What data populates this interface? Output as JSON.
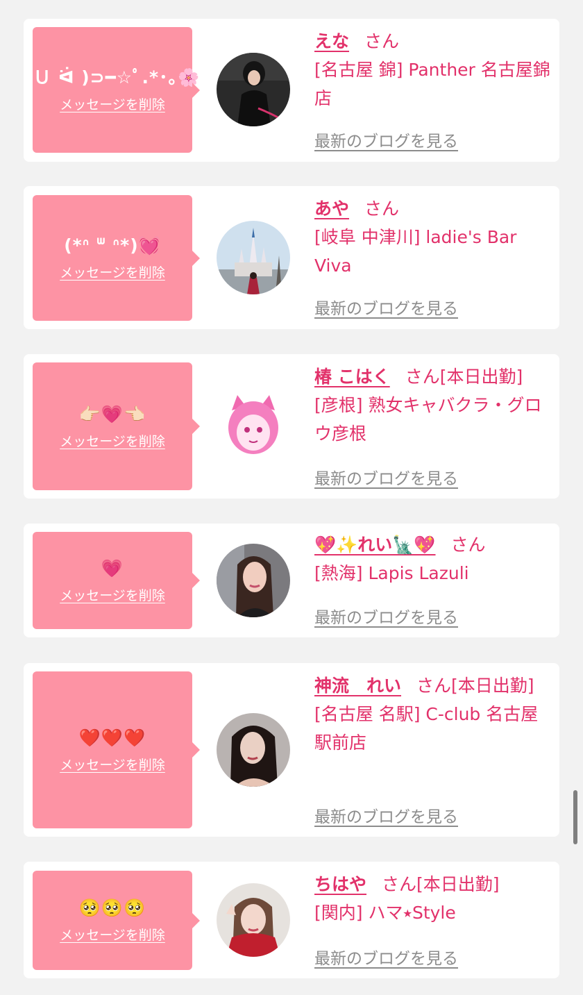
{
  "delete_label": "メッセージを削除",
  "blog_label": "最新のブログを見る",
  "colors": {
    "accent": "#e2316a",
    "bubble": "#fd93a4",
    "link_gray": "#8c8c8c",
    "background": "#f2f2f2"
  },
  "cards": [
    {
      "message": "(Ｕ ᐛ )⊃━☆ﾟ.*･｡🌸",
      "name": "えな",
      "honorific": "さん",
      "status": "",
      "shop": "[名古屋 錦] Panther 名古屋錦店",
      "avatar": "avatar-photo-panther"
    },
    {
      "message": "(*ᐢ ᐜ ᐢ*)💓",
      "name": "あや",
      "honorific": "さん",
      "status": "",
      "shop": "[岐阜 中津川] ladie's Bar Viva",
      "avatar": "avatar-photo-castle"
    },
    {
      "message": "👉🏻💗👈🏻",
      "name": "椿 こはく",
      "honorific": "さん",
      "status": "[本日出勤]",
      "shop": "[彦根] 熟女キャバクラ・グロウ彦根",
      "avatar": "avatar-illustration"
    },
    {
      "message": "💗",
      "name": "💖✨れい🗽💖",
      "honorific": "さん",
      "status": "",
      "shop": "[熱海] Lapis Lazuli",
      "avatar": "avatar-photo-woman"
    },
    {
      "message": "❤️❤️❤️",
      "name": "神流　れい",
      "honorific": "さん",
      "status": "[本日出勤]",
      "shop": "[名古屋 名駅] C-club 名古屋駅前店",
      "avatar": "avatar-photo-woman"
    },
    {
      "message": "🥺🥺🥺",
      "name": "ちはや",
      "honorific": "さん",
      "status": "[本日出勤]",
      "shop": "[関内] ハマ⭑Style",
      "avatar": "avatar-photo-woman"
    }
  ]
}
